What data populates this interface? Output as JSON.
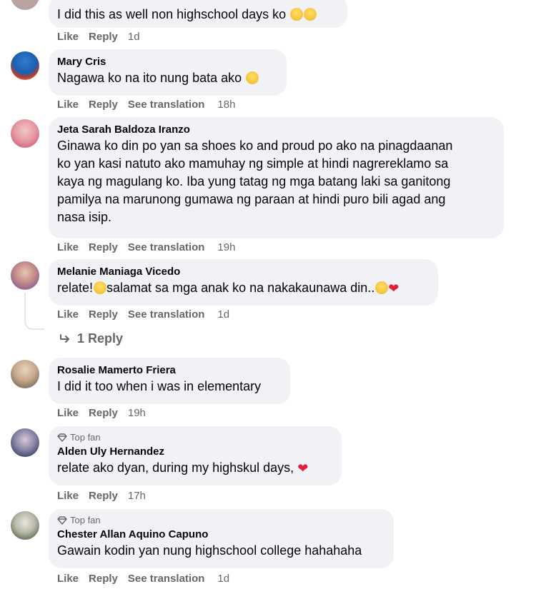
{
  "comments": [
    {
      "text": "I did this as well non highschool days ko",
      "actions": {
        "like": "Like",
        "reply": "Reply",
        "time": "1d"
      }
    },
    {
      "author": "Mary Cris",
      "text": "Nagawa ko na ito nung bata ako",
      "actions": {
        "like": "Like",
        "reply": "Reply",
        "translate": "See translation",
        "time": "18h"
      }
    },
    {
      "author": "Jeta Sarah Baldoza Iranzo",
      "text_lines": [
        "Ginawa ko din po yan sa shoes ko and proud po ako na pinagdaanan",
        "ko yan kasi natuto ako mamuhay ng simple at hindi nagrereklamo sa",
        "kaya ng magulang ko. Iba yung tatag ng mga batang laki sa ganitong",
        "pamilya na marunong gumawa ng paraan at hindi puro bili agad ang",
        "nasa isip."
      ],
      "actions": {
        "like": "Like",
        "reply": "Reply",
        "translate": "See translation",
        "time": "19h"
      }
    },
    {
      "author": "Melanie Maniaga Vicedo",
      "text_a": "relate!",
      "text_b": "salamat sa mga anak ko na nakakaunawa din..",
      "actions": {
        "like": "Like",
        "reply": "Reply",
        "translate": "See translation",
        "time": "1d"
      },
      "replies_label": "1 Reply"
    },
    {
      "author": "Rosalie Mamerto Friera",
      "text": "I did it too when i was in elementary",
      "actions": {
        "like": "Like",
        "reply": "Reply",
        "time": "19h"
      }
    },
    {
      "badge": "Top fan",
      "author": "Alden Uly Hernandez",
      "text": "relate ako dyan, during my highskul days,",
      "actions": {
        "like": "Like",
        "reply": "Reply",
        "time": "17h"
      }
    },
    {
      "badge": "Top fan",
      "author": "Chester Allan Aquino Capuno",
      "text": "Gawain kodin yan nung highschool college hahahaha",
      "actions": {
        "like": "Like",
        "reply": "Reply",
        "translate": "See translation",
        "time": "1d"
      }
    }
  ],
  "colors": {
    "bubble": "#f0f2f5",
    "meta": "#65676b",
    "heart": "#e41e3f"
  }
}
